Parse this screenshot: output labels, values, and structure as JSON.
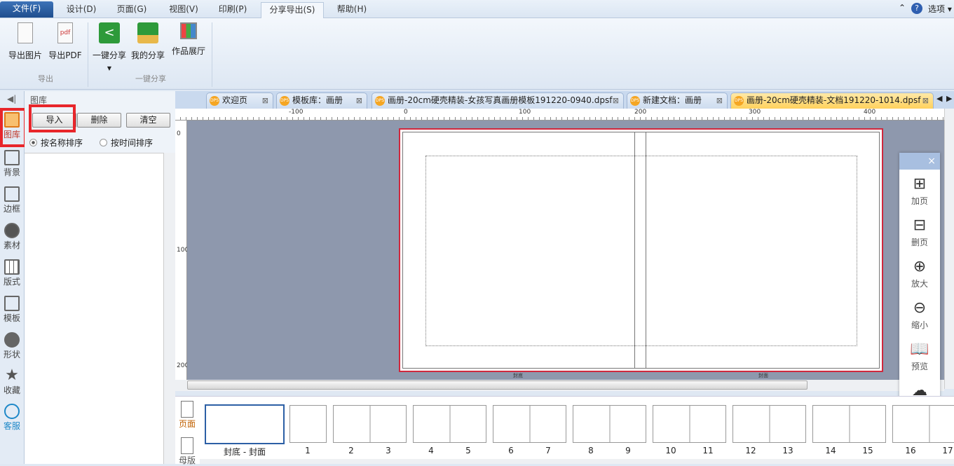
{
  "menu": {
    "items": [
      "文件(F)",
      "设计(D)",
      "页面(G)",
      "视图(V)",
      "印刷(P)",
      "分享导出(S)",
      "帮助(H)"
    ],
    "options": "选项"
  },
  "ribbon": {
    "buttons": [
      "导出图片",
      "导出PDF",
      "一键分享",
      "我的分享",
      "作品展厅"
    ],
    "groups": [
      "导出",
      "一键分享"
    ]
  },
  "sidebar": {
    "items": [
      "图库",
      "背景",
      "边框",
      "素材",
      "版式",
      "模板",
      "形状",
      "收藏",
      "客服"
    ]
  },
  "panel": {
    "title": "图库",
    "import": "导入",
    "delete": "删除",
    "clear": "清空",
    "sort_name": "按名称排序",
    "sort_time": "按时间排序"
  },
  "tabs": [
    "欢迎页",
    "模板库：画册",
    "画册-20cm硬壳精装-女孩写真画册模板191220-0940.dpsf",
    "新建文档：画册",
    "画册-20cm硬壳精装-文档191220-1014.dpsf"
  ],
  "ruler": {
    "h": [
      "-100",
      "0",
      "100",
      "200",
      "300",
      "400"
    ],
    "v": [
      "0",
      "100",
      "200"
    ]
  },
  "page": {
    "left_label": "封底",
    "right_label": "封面"
  },
  "float_panel": {
    "items": [
      "加页",
      "删页",
      "放大",
      "缩小",
      "预览",
      "分享"
    ]
  },
  "thumbnails": {
    "cover": "封底 - 封面",
    "pages": [
      "1",
      "2",
      "3",
      "4",
      "5",
      "6",
      "7",
      "8",
      "9",
      "10",
      "11",
      "12",
      "13",
      "14",
      "15",
      "16",
      "17"
    ]
  },
  "bottom_tabs": [
    "页面",
    "母版"
  ]
}
